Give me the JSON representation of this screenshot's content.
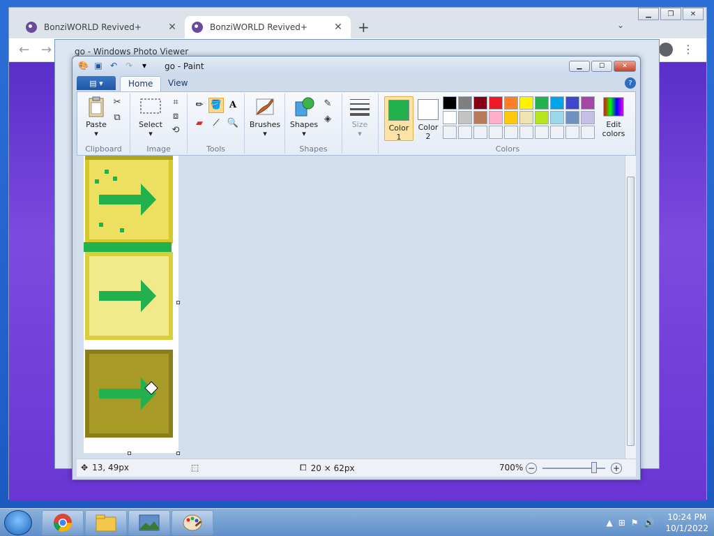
{
  "chrome": {
    "tabs": [
      {
        "label": "BonziWORLD Revived+"
      },
      {
        "label": "BonziWORLD Revived+"
      }
    ],
    "new_tab": "+",
    "tab_dropdown": "⌄"
  },
  "photo_viewer": {
    "title": "go - Windows Photo Viewer"
  },
  "paint": {
    "title": "go - Paint",
    "ribbon_tabs": {
      "home": "Home",
      "view": "View"
    },
    "clipboard": {
      "paste": "Paste",
      "label": "Clipboard"
    },
    "image": {
      "select": "Select",
      "label": "Image"
    },
    "tools": {
      "label": "Tools"
    },
    "brushes": {
      "label": "Brushes"
    },
    "shapes": {
      "button": "Shapes",
      "label": "Shapes"
    },
    "size": {
      "label": "Size"
    },
    "colors": {
      "color1_label": "Color\n1",
      "color2_label": "Color\n2",
      "color1_value": "#22b14c",
      "color2_value": "#ffffff",
      "edit_colors": "Edit colors",
      "label": "Colors",
      "palette": [
        "#000000",
        "#7f7f7f",
        "#880015",
        "#ed1c24",
        "#ff7f27",
        "#fff200",
        "#22b14c",
        "#00a2e8",
        "#3f48cc",
        "#a349a4",
        "#ffffff",
        "#c3c3c3",
        "#b97a57",
        "#ffaec9",
        "#ffc90e",
        "#efe4b0",
        "#b5e61d",
        "#99d9ea",
        "#7092be",
        "#c8bfe7"
      ]
    },
    "status": {
      "cursor_pos": "13, 49px",
      "canvas_size": "20 × 62px",
      "zoom": "700%"
    }
  },
  "taskbar": {
    "time": "10:24 PM",
    "date": "10/1/2022"
  }
}
